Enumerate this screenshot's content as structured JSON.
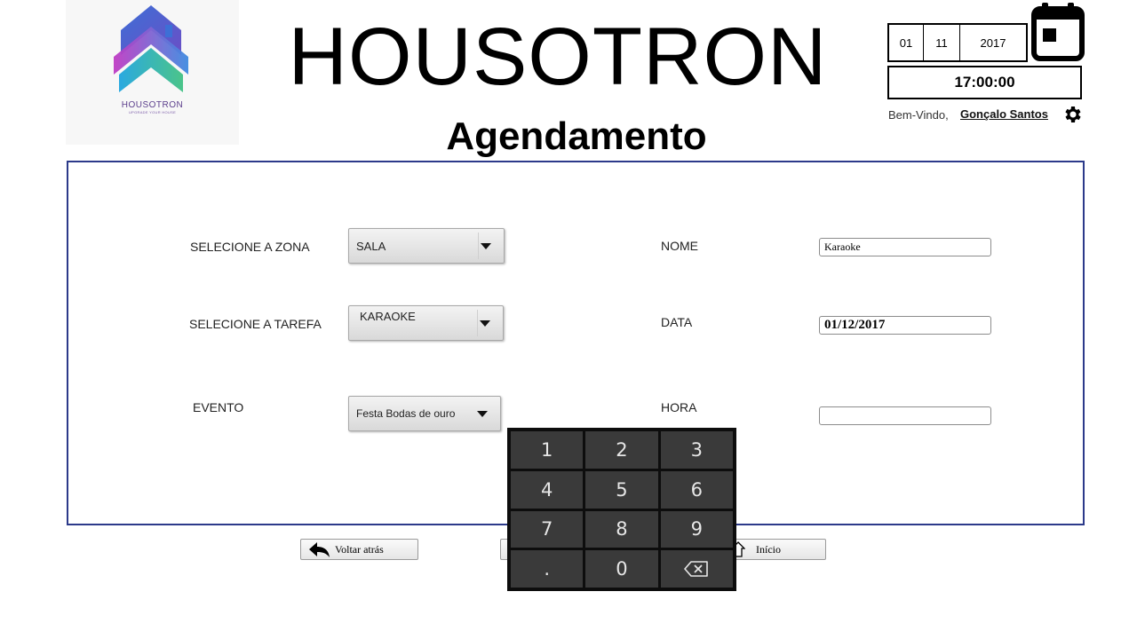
{
  "header": {
    "logo_text": "HOUSOTRON",
    "logo_tagline": "UPGRADE YOUR HOUSE",
    "app_title": "HOUSOTRON",
    "page_title": "Agendamento"
  },
  "datetime": {
    "day": "01",
    "month": "11",
    "year": "2017",
    "time": "17:00:00"
  },
  "user": {
    "welcome": "Bem-Vindo,",
    "name": "Gonçalo Santos"
  },
  "form": {
    "zone": {
      "label": "SELECIONE A ZONA",
      "value": "SALA"
    },
    "task": {
      "label": "SELECIONE A TAREFA",
      "value": "KARAOKE"
    },
    "event": {
      "label": "EVENTO",
      "value": "Festa Bodas de ouro"
    },
    "name": {
      "label": "NOME",
      "value": "Karaoke"
    },
    "date": {
      "label": "DATA",
      "value": "01/12/2017"
    },
    "hour": {
      "label": "HORA",
      "value": ""
    }
  },
  "keypad": {
    "keys": [
      "1",
      "2",
      "3",
      "4",
      "5",
      "6",
      "7",
      "8",
      "9",
      ".",
      "0"
    ],
    "backspace_icon": "backspace-icon"
  },
  "nav": {
    "back_label": "Voltar atrás",
    "home_label": "Início"
  },
  "colors": {
    "panel_border": "#2c3a8a",
    "keypad_bg": "#0d0d0d",
    "key_bg": "#3a3a3a"
  }
}
